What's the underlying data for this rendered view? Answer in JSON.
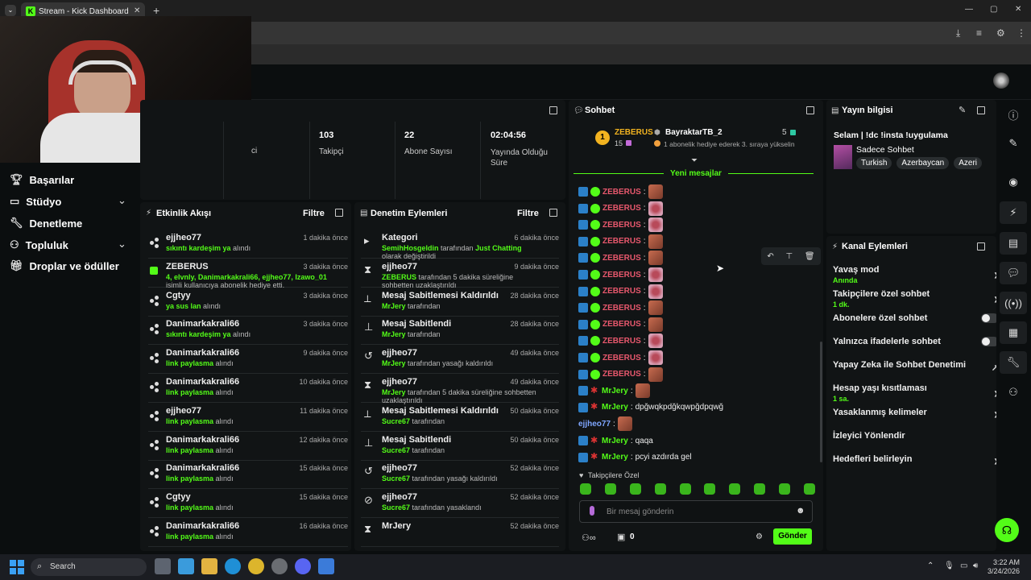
{
  "browser": {
    "tab_title": "Stream - Kick Dashboard",
    "new_tab": "+",
    "window_controls": [
      "—",
      "▢",
      "✕"
    ]
  },
  "sidebar": {
    "items": [
      {
        "label": "Başarılar",
        "icon": "trophy-icon"
      },
      {
        "label": "Stüdyo",
        "icon": "studio-icon",
        "expand": true
      },
      {
        "label": "Denetleme",
        "icon": "wrench-icon"
      },
      {
        "label": "Topluluk",
        "icon": "community-icon",
        "expand": true
      },
      {
        "label": "Droplar ve ödüller",
        "icon": "gift-icon"
      }
    ]
  },
  "stats": {
    "partial_label": "ci",
    "items": [
      {
        "value": "103",
        "label": "Takipçi"
      },
      {
        "value": "22",
        "label": "Abone Sayısı"
      },
      {
        "value": "02:04:56",
        "label": "Yayında Olduğu Süre"
      }
    ]
  },
  "activity": {
    "title": "Etkinlik Akışı",
    "filter": "Filtre",
    "rows": [
      {
        "name": "ejjheo77",
        "time": "1 dakika önce",
        "hl": "sıkıntı kardeşim ya",
        "rest": " alındı"
      },
      {
        "name": "ZEBERUS",
        "time": "3 dakika önce",
        "hl": "4, elvnly, Danimarkakrali66, ejjheo77, Izawo_01",
        "rest": " isimli kullanıcıya abonelik hediye etti."
      },
      {
        "name": "Cgtyy",
        "time": "3 dakika önce",
        "hl": "ya sus lan",
        "rest": " alındı"
      },
      {
        "name": "Danimarkakrali66",
        "time": "3 dakika önce",
        "hl": "sıkıntı kardeşim ya",
        "rest": " alındı"
      },
      {
        "name": "Danimarkakrali66",
        "time": "9 dakika önce",
        "hl": "link paylasma",
        "rest": " alındı"
      },
      {
        "name": "Danimarkakrali66",
        "time": "10 dakika önce",
        "hl": "link paylasma",
        "rest": " alındı"
      },
      {
        "name": "ejjheo77",
        "time": "11 dakika önce",
        "hl": "link paylasma",
        "rest": " alındı"
      },
      {
        "name": "Danimarkakrali66",
        "time": "12 dakika önce",
        "hl": "link paylasma",
        "rest": " alındı"
      },
      {
        "name": "Danimarkakrali66",
        "time": "15 dakika önce",
        "hl": "link paylasma",
        "rest": " alındı"
      },
      {
        "name": "Cgtyy",
        "time": "15 dakika önce",
        "hl": "link paylasma",
        "rest": " alındı"
      },
      {
        "name": "Danimarkakrali66",
        "time": "16 dakika önce",
        "hl": "link paylasma",
        "rest": " alındı"
      }
    ]
  },
  "moderation": {
    "title": "Denetim Eylemleri",
    "filter": "Filtre",
    "rows": [
      {
        "name": "Kategori",
        "time": "6 dakika önce",
        "icon": "category-icon",
        "who": "SemihHosgeldin",
        "mid": " tarafından ",
        "hl2": "Just Chatting",
        "rest": " olarak değiştirildi"
      },
      {
        "name": "ejjheo77",
        "time": "9 dakika önce",
        "icon": "hourglass-icon",
        "who": "ZEBERUS",
        "mid": " tarafından 5 dakika süreliğine sohbetten uzaklaştırıldı",
        "hl2": "",
        "rest": ""
      },
      {
        "name": "Mesaj Sabitlemesi Kaldırıldı",
        "time": "28 dakika önce",
        "icon": "unpin-icon",
        "who": "MrJery",
        "mid": " tarafından",
        "hl2": "",
        "rest": ""
      },
      {
        "name": "Mesaj Sabitlendi",
        "time": "28 dakika önce",
        "icon": "pin-icon",
        "who": "MrJery",
        "mid": " tarafından",
        "hl2": "",
        "rest": ""
      },
      {
        "name": "ejjheo77",
        "time": "49 dakika önce",
        "icon": "unban-icon",
        "who": "MrJery",
        "mid": " tarafından yasağı kaldırıldı",
        "hl2": "",
        "rest": ""
      },
      {
        "name": "ejjheo77",
        "time": "49 dakika önce",
        "icon": "hourglass-icon",
        "who": "MrJery",
        "mid": " tarafından 5 dakika süreliğine sohbetten uzaklaştırıldı",
        "hl2": "",
        "rest": ""
      },
      {
        "name": "Mesaj Sabitlemesi Kaldırıldı",
        "time": "50 dakika önce",
        "icon": "unpin-icon",
        "who": "Sucre67",
        "mid": " tarafından",
        "hl2": "",
        "rest": ""
      },
      {
        "name": "Mesaj Sabitlendi",
        "time": "50 dakika önce",
        "icon": "pin-icon",
        "who": "Sucre67",
        "mid": " tarafından",
        "hl2": "",
        "rest": ""
      },
      {
        "name": "ejjheo77",
        "time": "52 dakika önce",
        "icon": "unban-icon",
        "who": "Sucre67",
        "mid": " tarafından yasağı kaldırıldı",
        "hl2": "",
        "rest": ""
      },
      {
        "name": "ejjheo77",
        "time": "52 dakika önce",
        "icon": "ban-icon",
        "who": "Sucre67",
        "mid": " tarafından yasaklandı",
        "hl2": "",
        "rest": ""
      },
      {
        "name": "MrJery",
        "time": "52 dakika önce",
        "icon": "hourglass-icon",
        "who": "",
        "mid": "",
        "hl2": "",
        "rest": ""
      }
    ]
  },
  "chat": {
    "title": "Sohbet",
    "top_rank": "1",
    "top_user": "ZEBERUS",
    "top_count": "15",
    "gifter_name": "BayraktarTB_2",
    "gifter_count": "5",
    "gifter_note": "1 abonelik hediye ederek 3. sıraya yükselin",
    "new_messages": "Yeni mesajlar",
    "messages": [
      {
        "user": "ZEBERUS",
        "color": "#e8586d",
        "emote": "em1",
        "text": ""
      },
      {
        "user": "ZEBERUS",
        "color": "#e8586d",
        "emote": "em2",
        "text": ""
      },
      {
        "user": "ZEBERUS",
        "color": "#e8586d",
        "emote": "em2",
        "text": ""
      },
      {
        "user": "ZEBERUS",
        "color": "#e8586d",
        "emote": "em1",
        "text": ""
      },
      {
        "user": "ZEBERUS",
        "color": "#e8586d",
        "emote": "em1",
        "text": ""
      },
      {
        "user": "ZEBERUS",
        "color": "#e8586d",
        "emote": "em2",
        "text": ""
      },
      {
        "user": "ZEBERUS",
        "color": "#e8586d",
        "emote": "em2",
        "text": ""
      },
      {
        "user": "ZEBERUS",
        "color": "#e8586d",
        "emote": "em1",
        "text": ""
      },
      {
        "user": "ZEBERUS",
        "color": "#e8586d",
        "emote": "em1",
        "text": ""
      },
      {
        "user": "ZEBERUS",
        "color": "#e8586d",
        "emote": "em2",
        "text": ""
      },
      {
        "user": "ZEBERUS",
        "color": "#e8586d",
        "emote": "em2",
        "text": ""
      },
      {
        "user": "ZEBERUS",
        "color": "#e8586d",
        "emote": "em1",
        "text": ""
      },
      {
        "user": "MrJery",
        "color": "#53fc18",
        "emote": "em1",
        "text": ""
      },
      {
        "user": "MrJery",
        "color": "#53fc18",
        "emote": "",
        "text": "dpğwqkpdğkqwpğdpqwğ"
      },
      {
        "user": "ejjheo77",
        "color": "#7fa6ff",
        "emote": "em1",
        "text": ""
      },
      {
        "user": "MrJery",
        "color": "#53fc18",
        "emote": "",
        "text": "qaqa"
      },
      {
        "user": "MrJery",
        "color": "#53fc18",
        "emote": "",
        "text": "pcyi azdırda gel"
      }
    ],
    "followers_only": "Takipçilere Özel",
    "input_placeholder": "Bir mesaj gönderin",
    "gift_count": "0",
    "send": "Gönder"
  },
  "stream_info": {
    "title": "Yayın bilgisi",
    "stream_title": "Selam | !dc !insta !uygulama",
    "category": "Sadece Sohbet",
    "tags": [
      "Turkish",
      "Azerbaycan",
      "Azeri"
    ]
  },
  "channel_actions": {
    "title": "Kanal Eylemleri",
    "items": [
      {
        "label": "Yavaş mod",
        "sub": "Anında",
        "ctrl": "chevron"
      },
      {
        "label": "Takipçilere özel sohbet",
        "sub": "1 dk.",
        "ctrl": "chevron"
      },
      {
        "label": "Abonelere özel sohbet",
        "sub": "",
        "ctrl": "toggle"
      },
      {
        "label": "Yalnızca ifadelerle sohbet",
        "sub": "",
        "ctrl": "toggle"
      },
      {
        "label": "Yapay Zeka ile Sohbet Denetimi",
        "sub": "",
        "ctrl": "ext"
      },
      {
        "label": "Hesap yaşı kısıtlaması",
        "sub": "1 sa.",
        "ctrl": "chevron"
      },
      {
        "label": "Yasaklanmış kelimeler",
        "sub": "",
        "ctrl": "chevron"
      },
      {
        "label": "İzleyici Yönlendir",
        "sub": "",
        "ctrl": ""
      },
      {
        "label": "Hedefleri belirleyin",
        "sub": "",
        "ctrl": "chevron"
      }
    ]
  },
  "taskbar": {
    "search": "Search",
    "time": "3:22 AM",
    "date": "3/24/2026"
  },
  "colors": {
    "accent": "#53fc18",
    "panel": "#111415",
    "bg": "#0b0e0f"
  }
}
